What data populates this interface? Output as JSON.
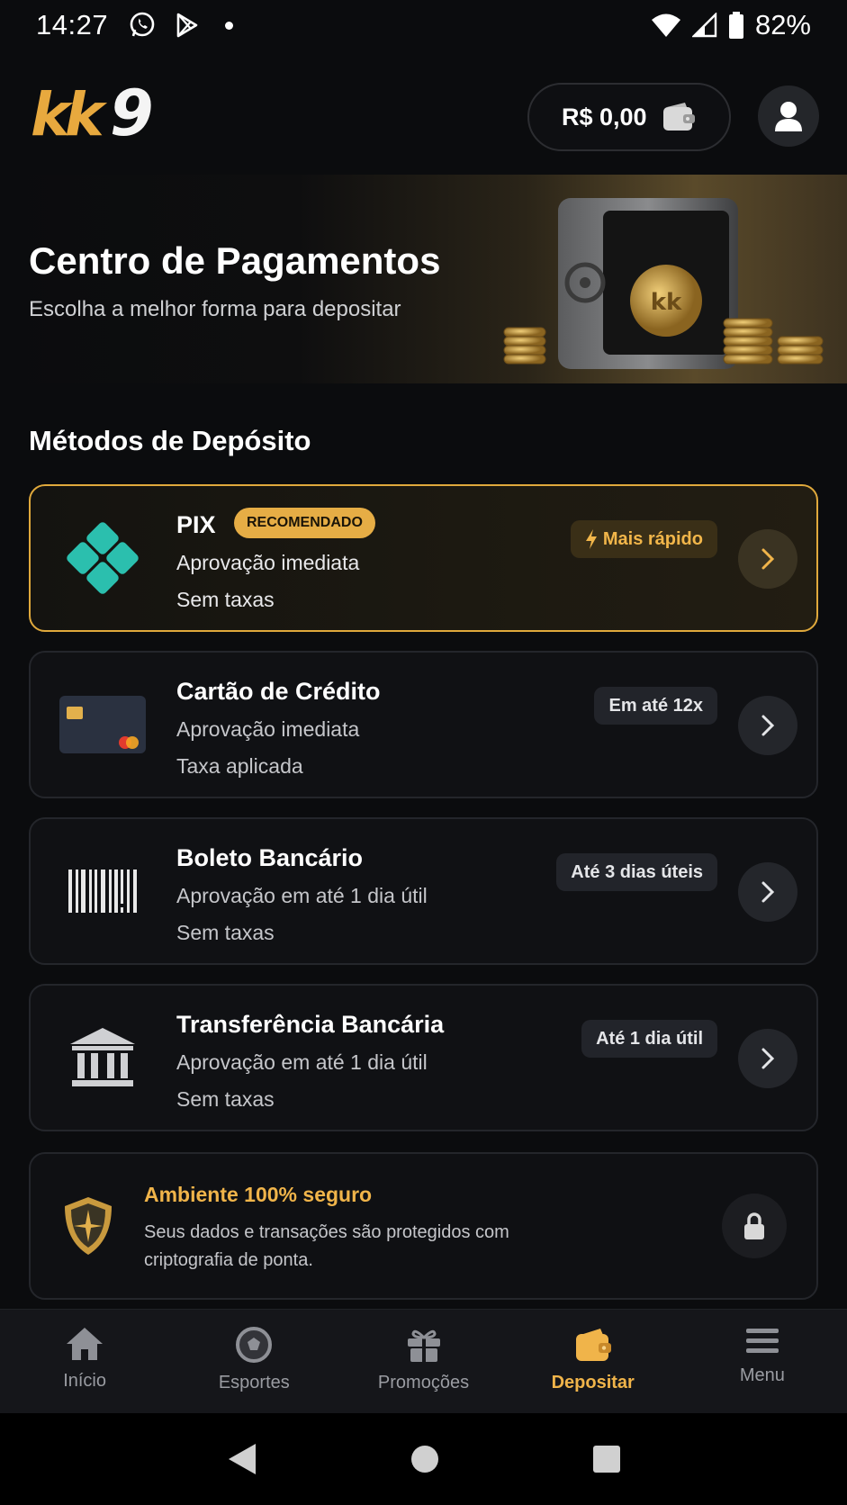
{
  "status_bar": {
    "time": "14:27",
    "battery": "82%"
  },
  "header": {
    "logo_text": "kk9",
    "balance": "R$ 0,00"
  },
  "banner": {
    "title": "Centro de Pagamentos",
    "subtitle": "Escolha a melhor forma para depositar"
  },
  "section_title": "Métodos de Depósito",
  "methods": [
    {
      "name": "PIX",
      "badge": "RECOMENDADO",
      "line1": "Aprovação imediata",
      "line2": "Sem taxas",
      "tag": "Mais rápido",
      "icon": "pix-icon"
    },
    {
      "name": "Cartão de Crédito",
      "line1": "Aprovação imediata",
      "line2": "Taxa aplicada",
      "tag": "Em até 12x",
      "icon": "credit-card-icon"
    },
    {
      "name": "Boleto Bancário",
      "line1": "Aprovação em até 1 dia útil",
      "line2": "Sem taxas",
      "tag": "Até 3 dias úteis",
      "icon": "barcode-icon"
    },
    {
      "name": "Transferência Bancária",
      "line1": "Aprovação em até 1 dia útil",
      "line2": "Sem taxas",
      "tag": "Até 1 dia útil",
      "icon": "bank-icon"
    }
  ],
  "security": {
    "title": "Ambiente 100% seguro",
    "description": "Seus dados e transações são protegidos com criptografia de ponta."
  },
  "bottom_nav": [
    {
      "label": "Início",
      "icon": "home-icon"
    },
    {
      "label": "Esportes",
      "icon": "soccer-ball-icon"
    },
    {
      "label": "Promoções",
      "icon": "gift-icon"
    },
    {
      "label": "Depositar",
      "icon": "wallet-icon",
      "active": true
    },
    {
      "label": "Menu",
      "icon": "menu-icon"
    }
  ],
  "colors": {
    "accent": "#f0b44a",
    "pix": "#2bbfae",
    "background": "#0b0c0e"
  }
}
